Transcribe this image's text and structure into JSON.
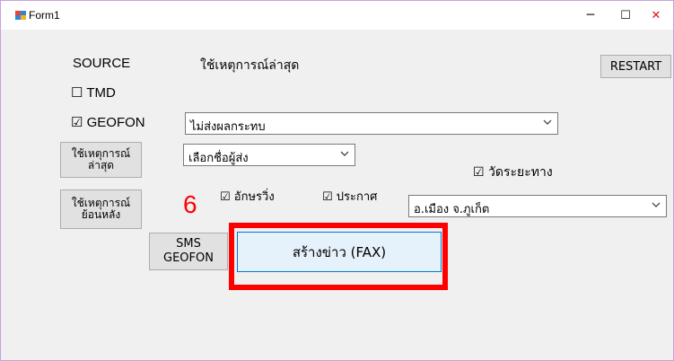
{
  "window": {
    "title": "Form1",
    "minimize": "─",
    "maximize": "☐",
    "close": "✕"
  },
  "source": {
    "label": "SOURCE",
    "value": "ใช้เหตุการณ์ล่าสุด"
  },
  "buttons": {
    "restart": "RESTART",
    "latest_line1": "ใช้เหตุการณ์",
    "latest_line2": "ล่าสุด",
    "past_line1": "ใช้เหตุการณ์",
    "past_line2": "ย้อนหลัง",
    "sms_line1": "SMS",
    "sms_line2": "GEOFON",
    "create_fax": "สร้างข่าว (FAX)"
  },
  "checkboxes": {
    "tmd": {
      "box": "☐",
      "label": "TMD"
    },
    "geofon": {
      "box": "☑",
      "label": "GEOFON"
    },
    "measure_distance": {
      "box": "☑",
      "label": "วัดระยะทาง"
    },
    "scrolling_text": {
      "box": "☑",
      "label": "อักษรวิ่ง"
    },
    "announcement": {
      "box": "☑",
      "label": "ประกาศ"
    }
  },
  "dropdowns": {
    "impact": "ไม่ส่งผลกระทบ",
    "sender": "เลือกชื่อผู้ส่ง",
    "location": "อ.เมือง จ.ภูเก็ต"
  },
  "annotation": {
    "step": "6",
    "color": "#ff0000"
  }
}
